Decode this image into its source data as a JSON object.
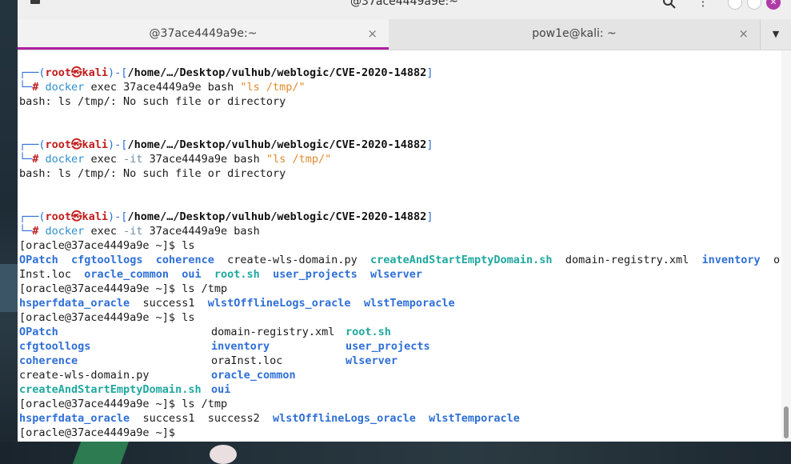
{
  "window": {
    "title": "@37ace4449a9e:~",
    "close_glyph": "✕",
    "menu_glyph": "⋮"
  },
  "tabs": [
    {
      "label": "@37ace4449a9e:~",
      "close_glyph": "×",
      "active": true
    },
    {
      "label": "pow1e@kali: ~",
      "close_glyph": "×",
      "active": false
    }
  ],
  "tab_menu_glyph": "▼",
  "colors": {
    "accent": "#b1209f",
    "dir": "#2e6fd6",
    "exe": "#1fa8a0",
    "prompt_user": "#c01c1c",
    "string": "#e08a2c"
  },
  "prompts": [
    {
      "bracket_open": "┌──(",
      "user": "root",
      "skull": "㉿",
      "host": "kali",
      "sep": ")-[",
      "path": "/home/…/Desktop/vulhub/weblogic/CVE-2020-14882",
      "bracket_close": "]",
      "arrow": "└─",
      "hash": "#",
      "cmd": "docker",
      "args": " exec 37ace4449a9e bash ",
      "flag": "",
      "string": "\"ls /tmp/\"",
      "output": "bash: ls /tmp/: No such file or directory"
    },
    {
      "bracket_open": "┌──(",
      "user": "root",
      "skull": "㉿",
      "host": "kali",
      "sep": ")-[",
      "path": "/home/…/Desktop/vulhub/weblogic/CVE-2020-14882",
      "bracket_close": "]",
      "arrow": "└─",
      "hash": "#",
      "cmd": "docker",
      "args_pre": " exec ",
      "flag": "-it",
      "args": " 37ace4449a9e bash ",
      "string": "\"ls /tmp/\"",
      "output": "bash: ls /tmp/: No such file or directory"
    },
    {
      "bracket_open": "┌──(",
      "user": "root",
      "skull": "㉿",
      "host": "kali",
      "sep": ")-[",
      "path": "/home/…/Desktop/vulhub/weblogic/CVE-2020-14882",
      "bracket_close": "]",
      "arrow": "└─",
      "hash": "#",
      "cmd": "docker",
      "args_pre": " exec ",
      "flag": "-it",
      "args": " 37ace4449a9e bash"
    }
  ],
  "session": {
    "prompt": "[oracle@37ace4449a9e ~]$",
    "ls1_cmd": " ls",
    "ls1_row1": {
      "a": "OPatch",
      "b": "cfgtoollogs",
      "c": "coherence",
      "d": "create-wls-domain.py",
      "e": "createAndStartEmptyDomain.sh",
      "f": "domain-registry.xml",
      "g": "inventory",
      "h": "ora"
    },
    "ls1_row2": {
      "a": "Inst.loc",
      "b": "oracle_common",
      "c": "oui",
      "d": "root.sh",
      "e": "user_projects",
      "f": "wlserver"
    },
    "lstmp1_cmd": " ls /tmp",
    "lstmp1": {
      "a": "hsperfdata_oracle",
      "b": "success1",
      "c": "wlstOfflineLogs_oracle",
      "d": "wlstTemporacle"
    },
    "ls2_cmd": " ls",
    "ls2_rows": [
      {
        "c1": "OPatch",
        "c2": "domain-registry.xml",
        "c3": "root.sh"
      },
      {
        "c1": "cfgtoollogs",
        "c2": "inventory",
        "c3": "user_projects"
      },
      {
        "c1": "coherence",
        "c2": "oraInst.loc",
        "c3": "wlserver"
      },
      {
        "c1": "create-wls-domain.py",
        "c2": "oracle_common",
        "c3": ""
      },
      {
        "c1": "createAndStartEmptyDomain.sh",
        "c2": "oui",
        "c3": ""
      }
    ],
    "lstmp2_cmd": " ls /tmp",
    "lstmp2": {
      "a": "hsperfdata_oracle",
      "b": "success1",
      "c": "success2",
      "d": "wlstOfflineLogs_oracle",
      "e": "wlstTemporacle"
    }
  }
}
